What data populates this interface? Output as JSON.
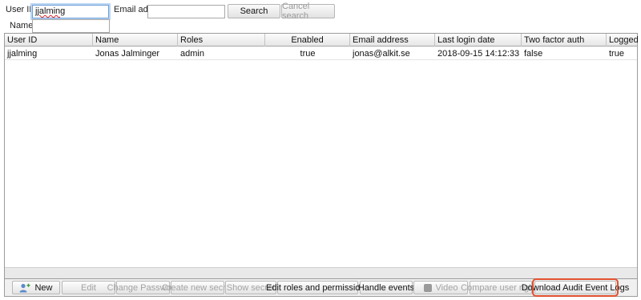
{
  "search": {
    "user_id_label": "User ID :",
    "user_id_value": "jjalming",
    "email_label": "Email addr :",
    "email_value": "",
    "name_label": "Name :",
    "name_value": "",
    "search_button": "Search",
    "cancel_button": "Cancel search"
  },
  "table": {
    "headers": [
      "User ID",
      "Name",
      "Roles",
      "Enabled",
      "Email address",
      "Last login date",
      "Two factor auth",
      "Logged in"
    ],
    "rows": [
      [
        "jjalming",
        "Jonas Jalminger",
        "admin",
        "true",
        "jonas@alkit.se",
        "2018-09-15 14:12:33",
        "false",
        "true"
      ]
    ]
  },
  "toolbar": {
    "new": "New",
    "edit": "Edit",
    "change_password": "Change Password",
    "create_secret": "Create new secret",
    "show_secret": "Show secret",
    "edit_roles": "Edit roles and permissions",
    "handle_events": "Handle events",
    "video": "Video",
    "compare_rights": "Compare user rights",
    "download_audit": "Download Audit Event Logs"
  },
  "icons": {
    "new": "add-user-icon",
    "video": "video-icon"
  },
  "colors": {
    "highlight": "#e2512f",
    "focus": "#6fa0d8"
  }
}
